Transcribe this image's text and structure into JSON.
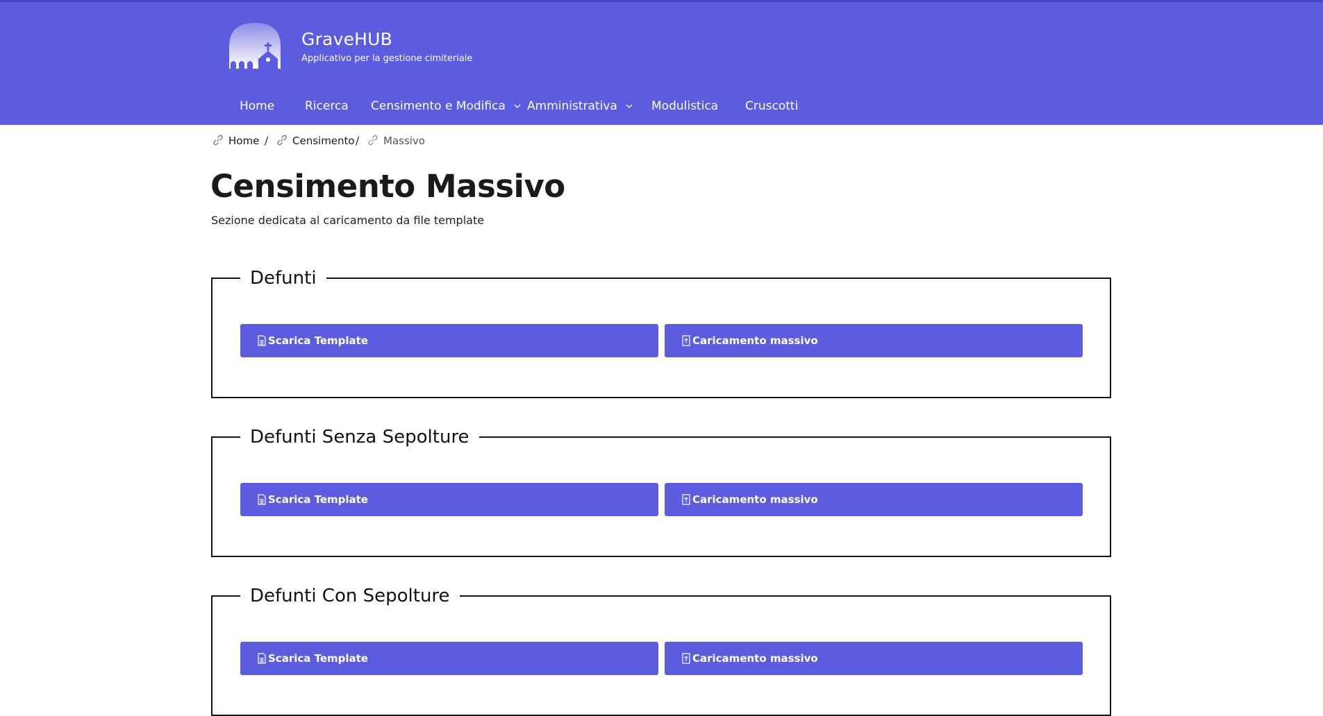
{
  "brand": {
    "title": "GraveHUB",
    "subtitle": "Applicativo per la gestione cimiteriale",
    "logo_icon": "cemetery-chapel-logo"
  },
  "nav": {
    "items": [
      {
        "label": "Home",
        "dropdown": false
      },
      {
        "label": "Ricerca",
        "dropdown": false
      },
      {
        "label": "Censimento e Modifica",
        "dropdown": true
      },
      {
        "label": "Amministrativa",
        "dropdown": true
      },
      {
        "label": "Modulistica",
        "dropdown": false
      },
      {
        "label": "Cruscotti",
        "dropdown": false
      }
    ]
  },
  "breadcrumb": {
    "items": [
      "Home",
      "Censimento",
      "Massivo"
    ],
    "separator": "/"
  },
  "page": {
    "title": "Censimento Massivo",
    "subtitle": "Sezione dedicata al caricamento da file template"
  },
  "sections": [
    {
      "title": "Defunti",
      "download_label": "Scarica Template",
      "upload_label": "Caricamento massivo"
    },
    {
      "title": "Defunti Senza Sepolture",
      "download_label": "Scarica Template",
      "upload_label": "Caricamento massivo"
    },
    {
      "title": "Defunti Con Sepolture",
      "download_label": "Scarica Template",
      "upload_label": "Caricamento massivo"
    }
  ],
  "colors": {
    "primary": "#5c5ce0",
    "header_border": "#4444c4",
    "text": "#1a1a1a"
  }
}
